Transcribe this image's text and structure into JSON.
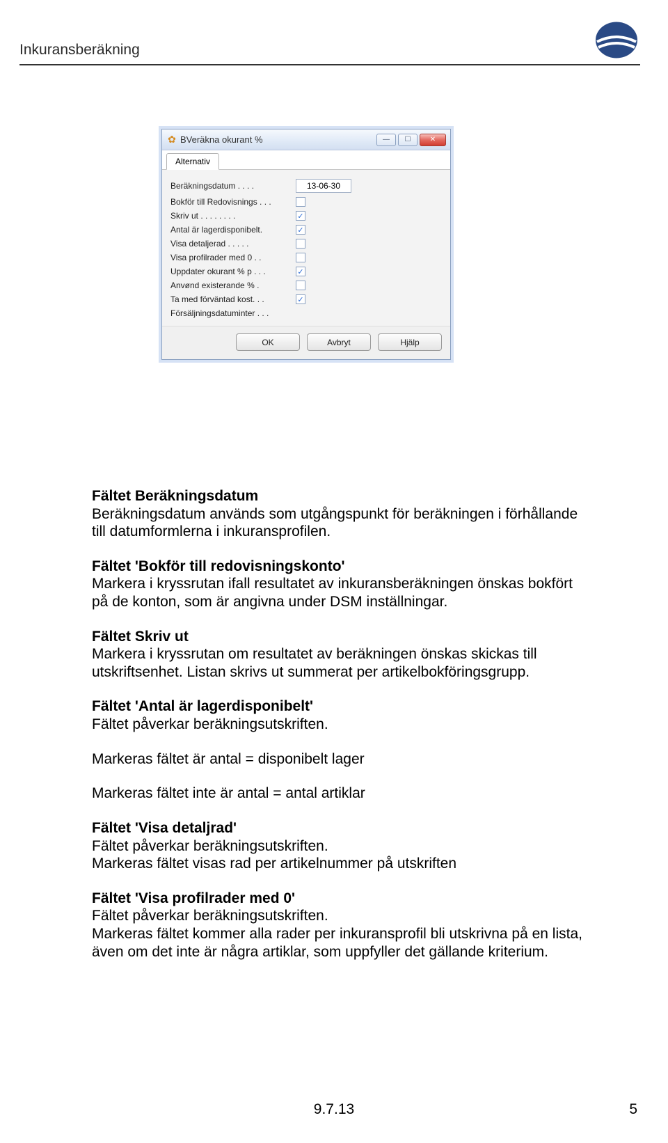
{
  "header": {
    "title": "Inkuransberäkning"
  },
  "window": {
    "title": "BVeräkna okurant %",
    "tab": "Alternativ",
    "rows": [
      {
        "label": "Beräkningsdatum  .  .  .  .",
        "type": "text",
        "value": "13-06-30"
      },
      {
        "label": "Bokför till Redovisnings . . .",
        "type": "check",
        "checked": false
      },
      {
        "label": "Skriv ut .  .  .  .  .  .  .  .",
        "type": "check",
        "checked": true
      },
      {
        "label": "Antal är lagerdisponibelt.",
        "type": "check",
        "checked": true
      },
      {
        "label": "Visa detaljerad  .  .  .  .  .",
        "type": "check",
        "checked": false
      },
      {
        "label": "Visa profilrader med 0  .  .",
        "type": "check",
        "checked": false
      },
      {
        "label": "Uppdater okurant % p . . .",
        "type": "check",
        "checked": true
      },
      {
        "label": "Anvønd existerande %  .",
        "type": "check",
        "checked": false
      },
      {
        "label": "Ta med förväntad kost. . .",
        "type": "check",
        "checked": true
      },
      {
        "label": "Försäljningsdatuminter . . .",
        "type": "none"
      }
    ],
    "buttons": {
      "ok": "OK",
      "cancel": "Avbryt",
      "help": "Hjälp"
    }
  },
  "content": {
    "s1_h": "Fältet Beräkningsdatum",
    "s1_p": "Beräkningsdatum används som utgångspunkt för beräkningen i förhållande till datumformlerna i inkuransprofilen.",
    "s2_h": "Fältet 'Bokför till redovisningskonto'",
    "s2_p": "Markera i kryssrutan ifall resultatet av inkuransberäkningen önskas bokfört på de konton, som är angivna under DSM inställningar.",
    "s3_h": "Fältet Skriv ut",
    "s3_p": "Markera i kryssrutan om resultatet av beräkningen önskas skickas till utskriftsenhet. Listan skrivs ut summerat per artikelbokföringsgrupp.",
    "s4_h": "Fältet 'Antal är lagerdisponibelt'",
    "s4_p": "Fältet påverkar beräkningsutskriften.",
    "s5_p": "Markeras fältet är antal = disponibelt lager",
    "s6_p": "Markeras fältet inte är antal = antal artiklar",
    "s7_h": "Fältet 'Visa detaljrad'",
    "s7_p1": "Fältet påverkar beräkningsutskriften.",
    "s7_p2": "Markeras fältet visas rad per artikelnummer på utskriften",
    "s8_h": "Fältet 'Visa profilrader med 0'",
    "s8_p1": "Fältet påverkar beräkningsutskriften.",
    "s8_p2": "Markeras fältet kommer alla rader per inkuransprofil bli utskrivna på en lista, även om det inte är några artiklar, som uppfyller det gällande kriterium."
  },
  "footer": {
    "date": "9.7.13",
    "page": "5"
  }
}
